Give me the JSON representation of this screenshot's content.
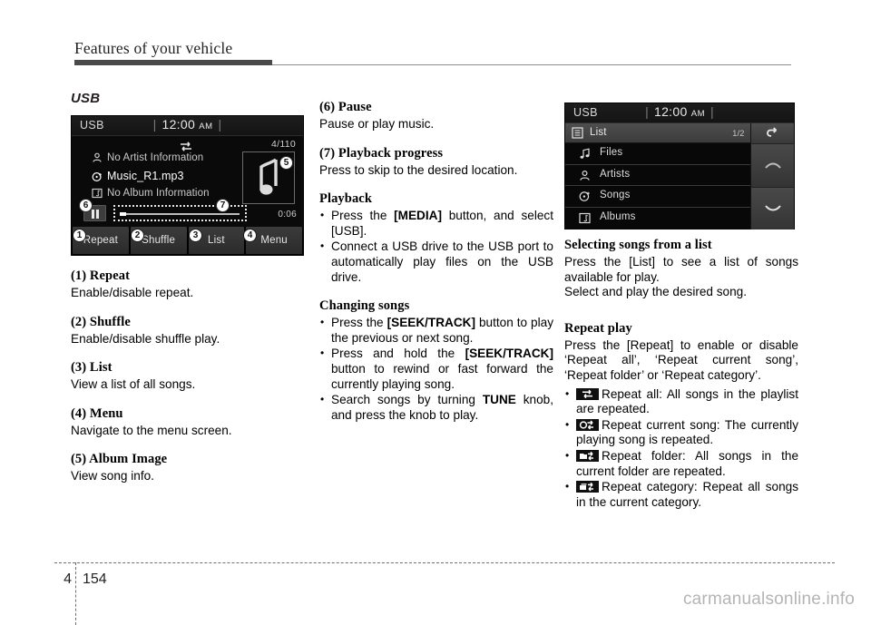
{
  "page": {
    "header_title": "Features of your vehicle",
    "chapter": "4",
    "page_number": "154",
    "watermark": "carmanualsonline.info"
  },
  "col1": {
    "section_title": "USB",
    "now_playing_screen": {
      "source": "USB",
      "clock_time": "12:00",
      "clock_ampm": "AM",
      "track_count": "4/110",
      "artist": "No Artist Information",
      "song": "Music_R1.mp3",
      "album": "No Album Information",
      "elapsed_time": "0:06",
      "softkeys": [
        "Repeat",
        "Shuffle",
        "List",
        "Menu"
      ],
      "callouts": [
        "1",
        "2",
        "3",
        "4",
        "5",
        "6",
        "7"
      ]
    },
    "items": [
      {
        "heading": "(1) Repeat",
        "body": "Enable/disable repeat."
      },
      {
        "heading": "(2) Shuffle",
        "body": "Enable/disable shuffle play."
      },
      {
        "heading": "(3) List",
        "body": "View a list of all songs."
      },
      {
        "heading": "(4) Menu",
        "body": "Navigate to the menu screen."
      },
      {
        "heading": "(5) Album Image",
        "body": "View song info."
      }
    ]
  },
  "col2": {
    "items": [
      {
        "heading": "(6) Pause",
        "body": "Pause or play music."
      },
      {
        "heading": "(7) Playback progress",
        "body": "Press to skip to the desired location."
      }
    ],
    "playback": {
      "heading": "Playback",
      "bullets": [
        {
          "pre": "Press the ",
          "bold": "[MEDIA]",
          "post": " button, and select [USB]."
        },
        {
          "pre": "Connect a USB drive to the USB port to automatically play files on the USB drive.",
          "bold": "",
          "post": ""
        }
      ]
    },
    "changing_songs": {
      "heading": "Changing songs",
      "bullets": [
        {
          "pre": "Press the ",
          "bold": "[SEEK/TRACK]",
          "post": " button to play the previous or next song."
        },
        {
          "pre": "Press and hold the ",
          "bold": "[SEEK/TRACK]",
          "post": " button to rewind or fast forward the currently playing song."
        },
        {
          "pre": "Search songs by turning ",
          "bold": "TUNE",
          "post": " knob, and press the knob to play."
        }
      ]
    }
  },
  "col3": {
    "list_screen": {
      "source": "USB",
      "clock_time": "12:00",
      "clock_ampm": "AM",
      "list_label": "List",
      "pager": "1/2",
      "items": [
        "Files",
        "Artists",
        "Songs",
        "Albums"
      ]
    },
    "selecting": {
      "heading": "Selecting songs from a list",
      "body1": "Press the [List] to see a list of songs available for play.",
      "body2": "Select and play the desired song."
    },
    "repeat_play": {
      "heading": "Repeat play",
      "body": "Press the [Repeat] to enable or disable ‘Repeat all’, ‘Repeat current song’, ‘Repeat folder’ or ‘Repeat category’.",
      "bullets": [
        {
          "icon": "repeat-all-icon",
          "text": "Repeat all: All songs in the playlist are repeated."
        },
        {
          "icon": "repeat-one-icon",
          "text": "Repeat current song: The currently playing song is repeated."
        },
        {
          "icon": "repeat-folder-icon",
          "text": "Repeat folder: All songs in the current folder are repeated."
        },
        {
          "icon": "repeat-category-icon",
          "text": "Repeat category: Repeat all songs in the current category."
        }
      ]
    }
  },
  "colors": {
    "rule_dark": "#4a4a4a",
    "text": "#000000",
    "screen_bg": "#000000",
    "watermark": "#b4b4b4"
  }
}
